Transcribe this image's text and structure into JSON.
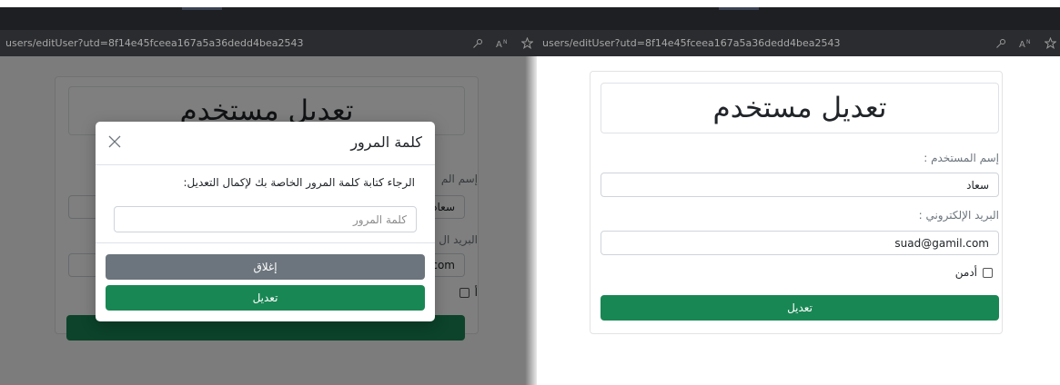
{
  "browser": {
    "left_url": "users/editUser?utd=8f14e45fceea167a5a36dedd4bea2543",
    "right_url": "users/editUser?utd=8f14e45fceea167a5a36dedd4bea2543"
  },
  "form": {
    "title": "تعديل مستخدم",
    "username_label": "إسم المستخدم :",
    "username_value": "سعاد",
    "email_label": "البريد الإلكتروني :",
    "email_value": "suad@gamil.com",
    "admin_label": "أدمن",
    "submit_label": "تعديل"
  },
  "background_fragments": {
    "username_label": "إسم الم",
    "username_value": "سعاد",
    "email_label": "البريد ال",
    "email_value": "com",
    "admin_label": "أ"
  },
  "modal": {
    "title": "كلمة المرور",
    "message": "الرجاء كتابة كلمة المرور الخاصة بك لإكمال التعديل:",
    "password_placeholder": "كلمة المرور",
    "close_button": "إغلاق",
    "submit_button": "تعديل"
  },
  "colors": {
    "primary_green": "#198754",
    "secondary_gray": "#6c757d",
    "browser_dark": "#2b2c2f"
  },
  "icons": [
    "close-icon",
    "key-icon",
    "read-aloud-icon",
    "favorite-star-icon"
  ]
}
